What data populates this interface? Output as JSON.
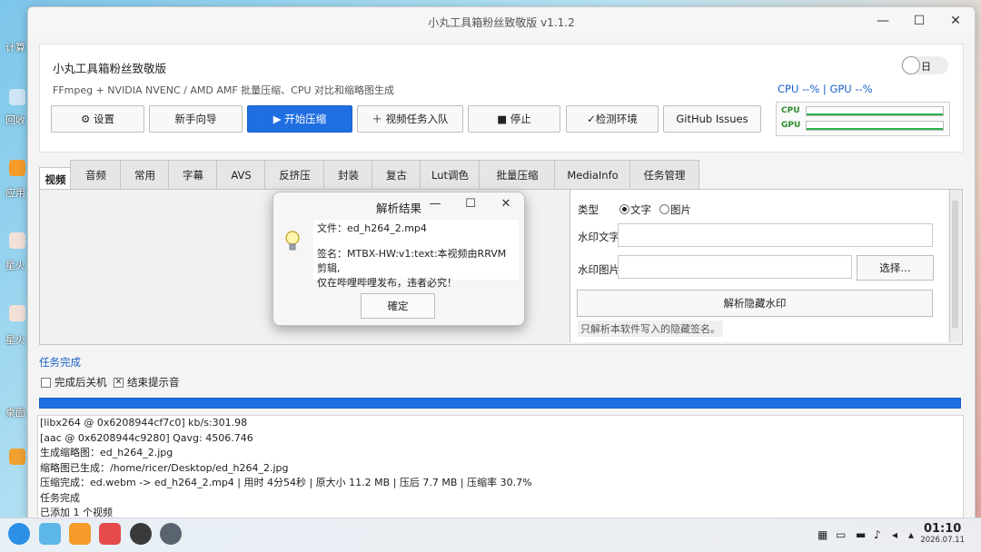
{
  "window": {
    "title": "小丸工具箱粉丝致敬版 v1.1.2",
    "minimize": "—",
    "maximize": "☐",
    "close": "✕"
  },
  "header": {
    "app_name": "小丸工具箱粉丝致敬版",
    "description": "FFmpeg + NVIDIA NVENC / AMD AMF 批量压缩、CPU 对比和缩略图生成",
    "theme_label": "日",
    "usage_text": "CPU --%  |  GPU --%",
    "cpu_label": "CPU",
    "gpu_label": "GPU"
  },
  "toolbar": [
    {
      "label": "⚙ 设置"
    },
    {
      "label": "新手向导"
    },
    {
      "label": "▶ 开始压缩"
    },
    {
      "label": "＋ 视频任务入队"
    },
    {
      "label": "■ 停止"
    },
    {
      "label": "✓检测环境"
    },
    {
      "label": "GitHub Issues"
    }
  ],
  "tabs": [
    "视频",
    "音频",
    "常用",
    "字幕",
    "AVS",
    "反挤压",
    "封装",
    "复古",
    "Lut调色",
    "批量压缩",
    "MediaInfo",
    "任务管理"
  ],
  "watermark": {
    "type_label": "类型",
    "opt_text": "文字",
    "opt_image": "图片",
    "text_label": "水印文字",
    "text_value": "",
    "image_label": "水印图片",
    "image_value": "",
    "choose_btn": "选择…",
    "parse_btn": "解析隐藏水印",
    "hint": "只解析本软件写入的隐藏签名。"
  },
  "dialog": {
    "title": "解析结果",
    "min": "—",
    "max": "☐",
    "close": "✕",
    "line1": "文件：ed_h264_2.mp4",
    "line2": "签名：MTBX-HW:v1:text:本视频由RRVM剪辑,",
    "line3": "仅在哔哩哔哩发布，违者必究！",
    "ok": "確定"
  },
  "status": {
    "done": "任务完成",
    "shutdown": "完成后关机",
    "sound": "结束提示音",
    "sound_mark": "✕",
    "progress": 1.0
  },
  "log": [
    "[libx264 @ 0x6208944cf7c0] kb/s:301.98",
    "[aac @ 0x6208944c9280] Qavg: 4506.746",
    "生成缩略图：ed_h264_2.jpg",
    "缩略图已生成：/home/ricer/Desktop/ed_h264_2.jpg",
    "压缩完成：ed.webm -> ed_h264_2.mp4 | 用时 4分54秒 | 原大小 11.2 MB | 压后 7.7 MB | 压缩率 30.7%",
    "任务完成",
    "已添加 1 个视频"
  ],
  "taskbar": {
    "time": "01:10",
    "date": "2026.07.11"
  },
  "colors": {
    "accent": "#1f6ee2",
    "usage_green": "#2bb24c"
  }
}
